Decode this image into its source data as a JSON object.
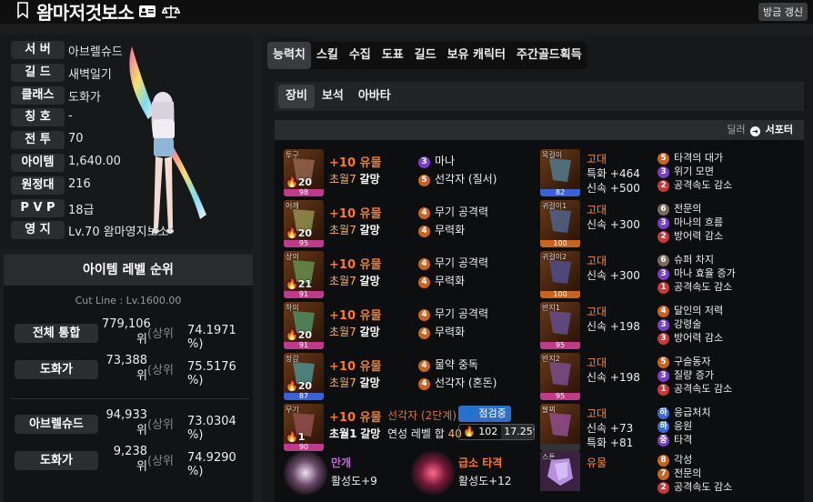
{
  "header": {
    "title": "왐마저것보소",
    "refresh_label": "방금 갱신"
  },
  "profile": [
    {
      "k": "서 버",
      "v": "아브렐슈드"
    },
    {
      "k": "길 드",
      "v": "새벽일기"
    },
    {
      "k": "클래스",
      "v": "도화가"
    },
    {
      "k": "칭 호",
      "v": "-"
    },
    {
      "k": "전 투",
      "v": "70"
    },
    {
      "k": "아이템",
      "v": "1,640.00"
    },
    {
      "k": "원정대",
      "v": "216"
    },
    {
      "k": "P V P",
      "v": "18급"
    },
    {
      "k": "영 지",
      "v": "Lv.70 왐마영지보소"
    }
  ],
  "ranking": {
    "title": "아이템 레벨 순위",
    "cut_line": "Cut Line : Lv.1600.00",
    "rows": [
      {
        "k": "전체 통합",
        "n1": "779,106",
        "n2": "위",
        "u": "(상위",
        "p": "74.1971 %)"
      },
      {
        "k": "도화가",
        "n1": "73,388",
        "n2": "위",
        "u": "(상위",
        "p": "75.5176 %)"
      },
      {
        "k": "아브렐슈드",
        "n1": "94,933",
        "n2": "위",
        "u": "(상위",
        "p": "73.0304 %)"
      },
      {
        "k": "도화가",
        "n1": "9,238",
        "n2": "위",
        "u": "(상위",
        "p": "74.9290 %)"
      }
    ]
  },
  "tabs": [
    "능력치",
    "스킬",
    "수집",
    "도표",
    "길드",
    "보유 캐릭터",
    "주간골드획득"
  ],
  "subtabs": [
    "장비",
    "보석",
    "아바타"
  ],
  "toggle": {
    "a": "딜러",
    "b": "서포터"
  },
  "equipment": [
    {
      "slot": "투구",
      "lv": "20",
      "q": "98",
      "qc": "#c03a8a",
      "enh": "+10 유물",
      "tr1": "초월7",
      "tr2": "갈망",
      "e1": {
        "n": "3",
        "c": "#7a3dc8",
        "t": "마나"
      },
      "e2": {
        "n": "5",
        "c": "#c8641e",
        "t": "선각자 (질서)"
      }
    },
    {
      "slot": "어깨",
      "lv": "20",
      "q": "95",
      "qc": "#c03a8a",
      "enh": "+10 유물",
      "tr1": "초월7",
      "tr2": "갈망",
      "e1": {
        "n": "4",
        "c": "#c8641e",
        "t": "무기 공격력"
      },
      "e2": {
        "n": "4",
        "c": "#c8641e",
        "t": "무력화"
      }
    },
    {
      "slot": "상의",
      "lv": "21",
      "q": "91",
      "qc": "#c03a8a",
      "enh": "+10 유물",
      "tr1": "초월7",
      "tr2": "갈망",
      "e1": {
        "n": "4",
        "c": "#c8641e",
        "t": "무기 공격력"
      },
      "e2": {
        "n": "4",
        "c": "#c8641e",
        "t": "무력화"
      }
    },
    {
      "slot": "하의",
      "lv": "20",
      "q": "91",
      "qc": "#c03a8a",
      "enh": "+10 유물",
      "tr1": "초월7",
      "tr2": "갈망",
      "e1": {
        "n": "4",
        "c": "#c8641e",
        "t": "무기 공격력"
      },
      "e2": {
        "n": "4",
        "c": "#c8641e",
        "t": "무력화"
      }
    },
    {
      "slot": "장갑",
      "lv": "20",
      "q": "87",
      "qc": "#3a62d8",
      "enh": "+10 유물",
      "tr1": "초월7",
      "tr2": "갈망",
      "e1": {
        "n": "4",
        "c": "#c8641e",
        "t": "물약 중독"
      },
      "e2": {
        "n": "4",
        "c": "#c8641e",
        "t": "선각자 (혼돈)"
      }
    }
  ],
  "weapon": {
    "slot": "무기",
    "lv": "1",
    "q": "90",
    "qc": "#c03a8a",
    "enh": "+10 유물",
    "tr1": "초월1",
    "tr2": "갈망",
    "elixir": "선각자 (2단계)",
    "elixir_total_label": "연성 레벨 합",
    "elixir_total": "40",
    "check_label": "점검중",
    "q2_value": "102",
    "q2_pct": "17.25%"
  },
  "accessories": [
    {
      "slot": "목걸이",
      "q": "82",
      "qc": "#3a62d8",
      "grade": "고대",
      "s1": "특화 +464",
      "s2": "신속 +500",
      "fx": [
        {
          "n": "5",
          "c": "#c8641e",
          "t": "타격의 대가"
        },
        {
          "n": "3",
          "c": "#7a3dc8",
          "t": "위기 모면"
        },
        {
          "n": "2",
          "c": "#c83a3a",
          "t": "공격속도 감소"
        }
      ]
    },
    {
      "slot": "귀걸이1",
      "q": "100",
      "qc": "#c8641e",
      "grade": "고대",
      "s1": "신속 +300",
      "s2": "",
      "fx": [
        {
          "n": "6",
          "c": "#7a6a5a",
          "t": "전문의"
        },
        {
          "n": "3",
          "c": "#7a3dc8",
          "t": "마나의 흐름"
        },
        {
          "n": "2",
          "c": "#c83a3a",
          "t": "방어력 감소"
        }
      ]
    },
    {
      "slot": "귀걸이2",
      "q": "100",
      "qc": "#c8641e",
      "grade": "고대",
      "s1": "신속 +300",
      "s2": "",
      "fx": [
        {
          "n": "6",
          "c": "#7a6a5a",
          "t": "슈퍼 차지"
        },
        {
          "n": "3",
          "c": "#7a3dc8",
          "t": "마나 효율 증가"
        },
        {
          "n": "1",
          "c": "#c83a3a",
          "t": "공격속도 감소"
        }
      ]
    },
    {
      "slot": "반지1",
      "q": "95",
      "qc": "#c03a8a",
      "grade": "고대",
      "s1": "신속 +198",
      "s2": "",
      "fx": [
        {
          "n": "4",
          "c": "#c8641e",
          "t": "달인의 저력"
        },
        {
          "n": "3",
          "c": "#7a3dc8",
          "t": "강령술"
        },
        {
          "n": "3",
          "c": "#c83a3a",
          "t": "방어력 감소"
        }
      ]
    },
    {
      "slot": "반지2",
      "q": "95",
      "qc": "#c03a8a",
      "grade": "고대",
      "s1": "신속 +198",
      "s2": "",
      "fx": [
        {
          "n": "5",
          "c": "#c8641e",
          "t": "구슬동자"
        },
        {
          "n": "3",
          "c": "#7a3dc8",
          "t": "질량 증가"
        },
        {
          "n": "1",
          "c": "#c83a3a",
          "t": "공격속도 감소"
        }
      ]
    },
    {
      "slot": "팔찌",
      "q": "",
      "qc": "#333",
      "grade": "고대",
      "s1": "신속 +73",
      "s2": "특화 +81",
      "fx": [
        {
          "n": "하",
          "c": "#3a6ad8",
          "t": "응급처치"
        },
        {
          "n": "하",
          "c": "#3a6ad8",
          "t": "응원"
        },
        {
          "n": "중",
          "c": "#7a3dc8",
          "t": "타격"
        }
      ]
    }
  ],
  "gems": [
    {
      "name": "만개",
      "sub": "활성도+9"
    },
    {
      "name": "급소 타격",
      "sub": "활성도+12"
    }
  ],
  "stone": {
    "slot": "스톤",
    "grade": "유물",
    "fx": [
      {
        "n": "8",
        "c": "#c8641e",
        "t": "각성"
      },
      {
        "n": "7",
        "c": "#c8641e",
        "t": "전문의"
      },
      {
        "n": "2",
        "c": "#c83a3a",
        "t": "공격속도 감소"
      }
    ]
  }
}
